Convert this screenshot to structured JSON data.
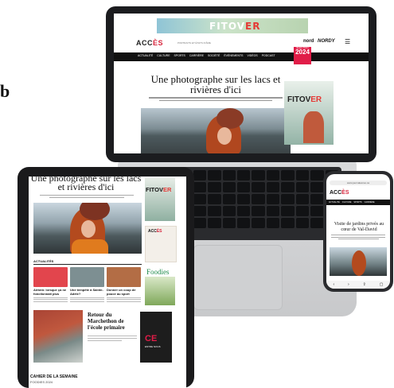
{
  "stray_letter": "b",
  "laptop": {
    "ad_brand": "FITOV",
    "ad_brand_accent": "ER",
    "logo_main": "ACC",
    "logo_accent": "ÈS",
    "tagline": "PORTRAITS ET ÉTATS D'ÂME",
    "partner1": "nord",
    "partner2": "NORDY",
    "menu_icon": "☰",
    "nav": [
      "ACTUALITÉ",
      "CULTURE",
      "SPORTS",
      "CARRIÈRE",
      "SOCIÉTÉ",
      "ÉVÉNEMENTS",
      "VIDÉOS",
      "PODCAST"
    ],
    "election_label": "ÉLECTION",
    "election_year": "2024",
    "headline": "Une photographe sur les lacs et rivières d'ici",
    "side_ad_brand": "FITOV",
    "side_ad_accent": "ER"
  },
  "tablet": {
    "headline": "Une photographe sur les lacs et rivières d'ici",
    "section_label": "ACTUALITÉS",
    "cards": [
      {
        "title": "Airbnb: lorsque ça ne fonctionnait plus",
        "color": "#e2454d"
      },
      {
        "title": "Une tempête à Sainte-Adèle?",
        "color": "#7d8f92"
      },
      {
        "title": "Donner un coup de pouce au sport",
        "color": "#b36d45"
      }
    ],
    "feature_title": "Retour du Marchethon de l'école primaire",
    "ce_label": "CE",
    "ce_small": "ENTRE NOUS",
    "cahier_title": "CAHIER DE LA SEMAINE",
    "cahier_sub": "FOODIES 2024",
    "right_ad_brand": "FITOV",
    "right_ad_accent": "ER",
    "acces_card_main": "ACC",
    "acces_card_accent": "ÈS",
    "foodies_label": "Foodies"
  },
  "phone": {
    "url": "www.journalacces.ca",
    "logo_main": "ACC",
    "logo_accent": "ÈS",
    "nav": [
      "ACTUALITÉ",
      "CULTURE",
      "SPORTS",
      "CARRIÈRE"
    ],
    "headline": "Visite de jardins privés au cœur de Val-David"
  }
}
